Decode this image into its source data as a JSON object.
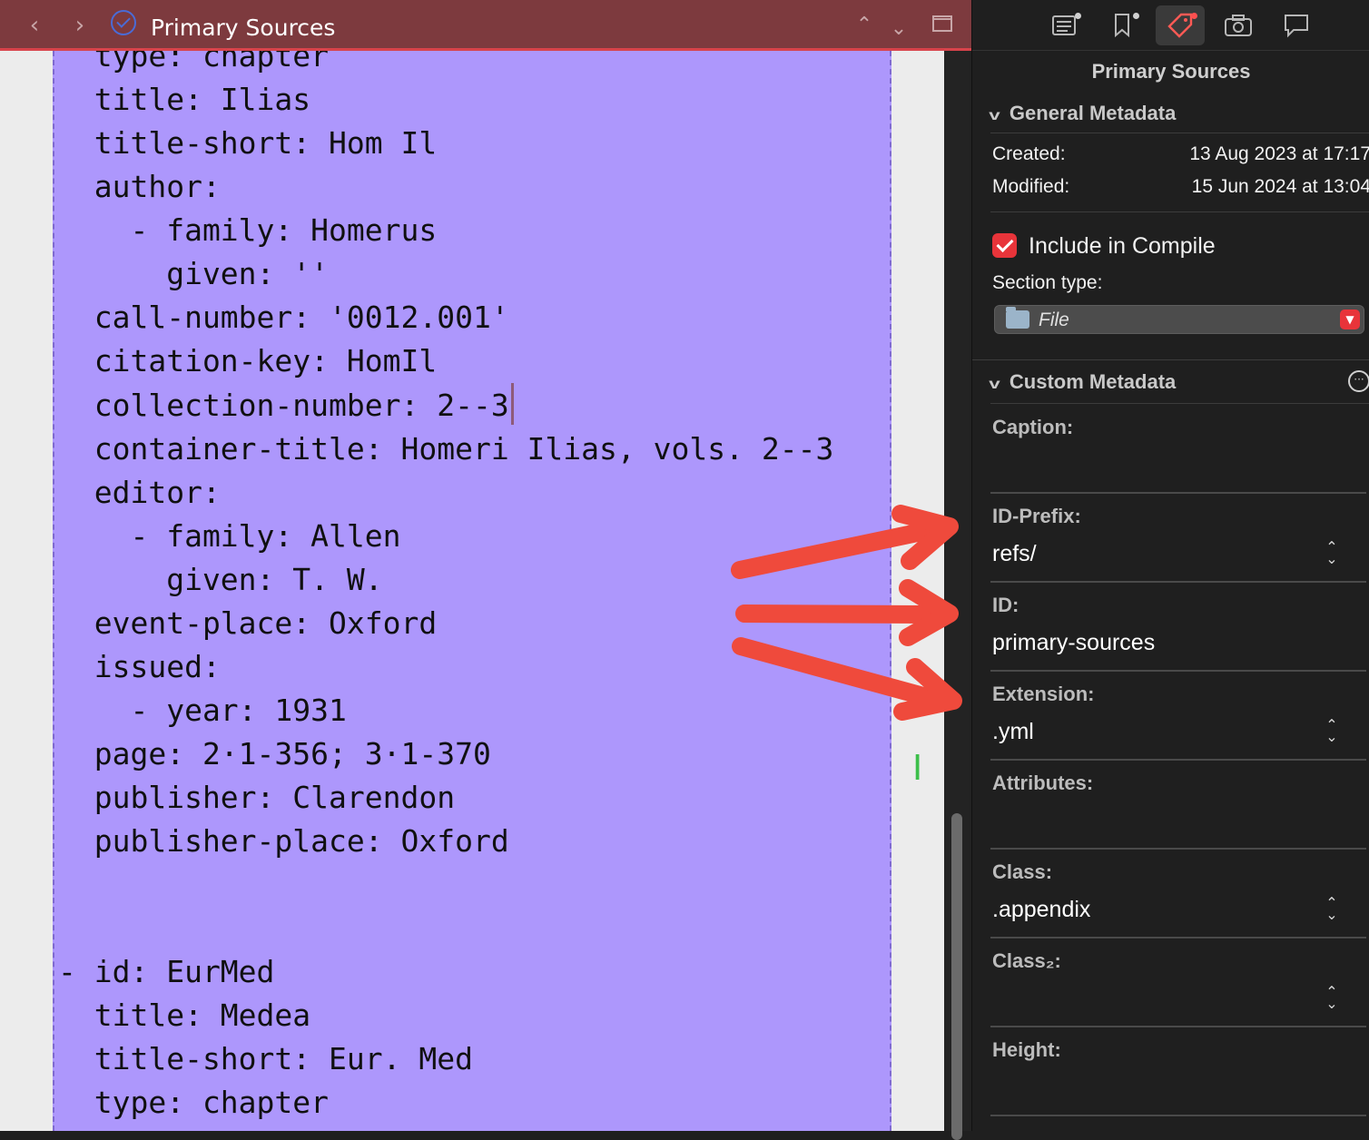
{
  "editor": {
    "title": "Primary Sources",
    "lines": [
      "  type: chapter",
      "  title: Ilias",
      "  title-short: Hom Il",
      "  author:",
      "    - family: Homerus",
      "      given: ''",
      "  call-number: '0012.001'",
      "  citation-key: HomIl",
      "  collection-number: 2--3",
      "  container-title: Homeri Ilias, vols. 2--3",
      "  editor:",
      "    - family: Allen",
      "      given: T. W.",
      "  event-place: Oxford",
      "  issued:",
      "    - year: 1931",
      "  page: 2·1-356; 3·1-370",
      "  publisher: Clarendon",
      "  publisher-place: Oxford",
      "",
      "",
      "- id: EurMed",
      "  title: Medea",
      "  title-short: Eur. Med",
      "  type: chapter"
    ],
    "cursor_line": 8
  },
  "toolbar_icons": [
    "back-icon",
    "forward-icon",
    "status-check-icon",
    "chevron-up-icon",
    "chevron-down-icon",
    "window-icon"
  ],
  "inspector": {
    "tabs": [
      "notes-icon",
      "bookmark-icon",
      "metadata-tag-icon",
      "snapshot-camera-icon",
      "comments-icon"
    ],
    "active_tab": "metadata-tag-icon",
    "title": "Primary Sources",
    "general_metadata": {
      "heading": "General Metadata",
      "created_label": "Created:",
      "created_value": "13 Aug 2023 at 17:17",
      "modified_label": "Modified:",
      "modified_value": "15 Jun 2024 at 13:04"
    },
    "include_in_compile": {
      "label": "Include in Compile",
      "checked": true
    },
    "section_type": {
      "label": "Section type:",
      "value": "File"
    },
    "custom_metadata": {
      "heading": "Custom Metadata",
      "fields": [
        {
          "label": "Caption:",
          "value": "",
          "stepper": false
        },
        {
          "label": "ID-Prefix:",
          "value": "refs/",
          "stepper": true
        },
        {
          "label": "ID:",
          "value": "primary-sources",
          "stepper": false
        },
        {
          "label": "Extension:",
          "value": ".yml",
          "stepper": true
        },
        {
          "label": "Attributes:",
          "value": "",
          "stepper": false
        },
        {
          "label": "Class:",
          "value": ".appendix",
          "stepper": true
        },
        {
          "label": "Class₂:",
          "value": "",
          "stepper": true
        },
        {
          "label": "Height:",
          "value": "",
          "stepper": false
        }
      ]
    }
  },
  "colors": {
    "titlebar": "#7d3a3e",
    "page_highlight": "#ad97fc",
    "arrow": "#ef4a3c",
    "accent_red": "#e8343a"
  }
}
